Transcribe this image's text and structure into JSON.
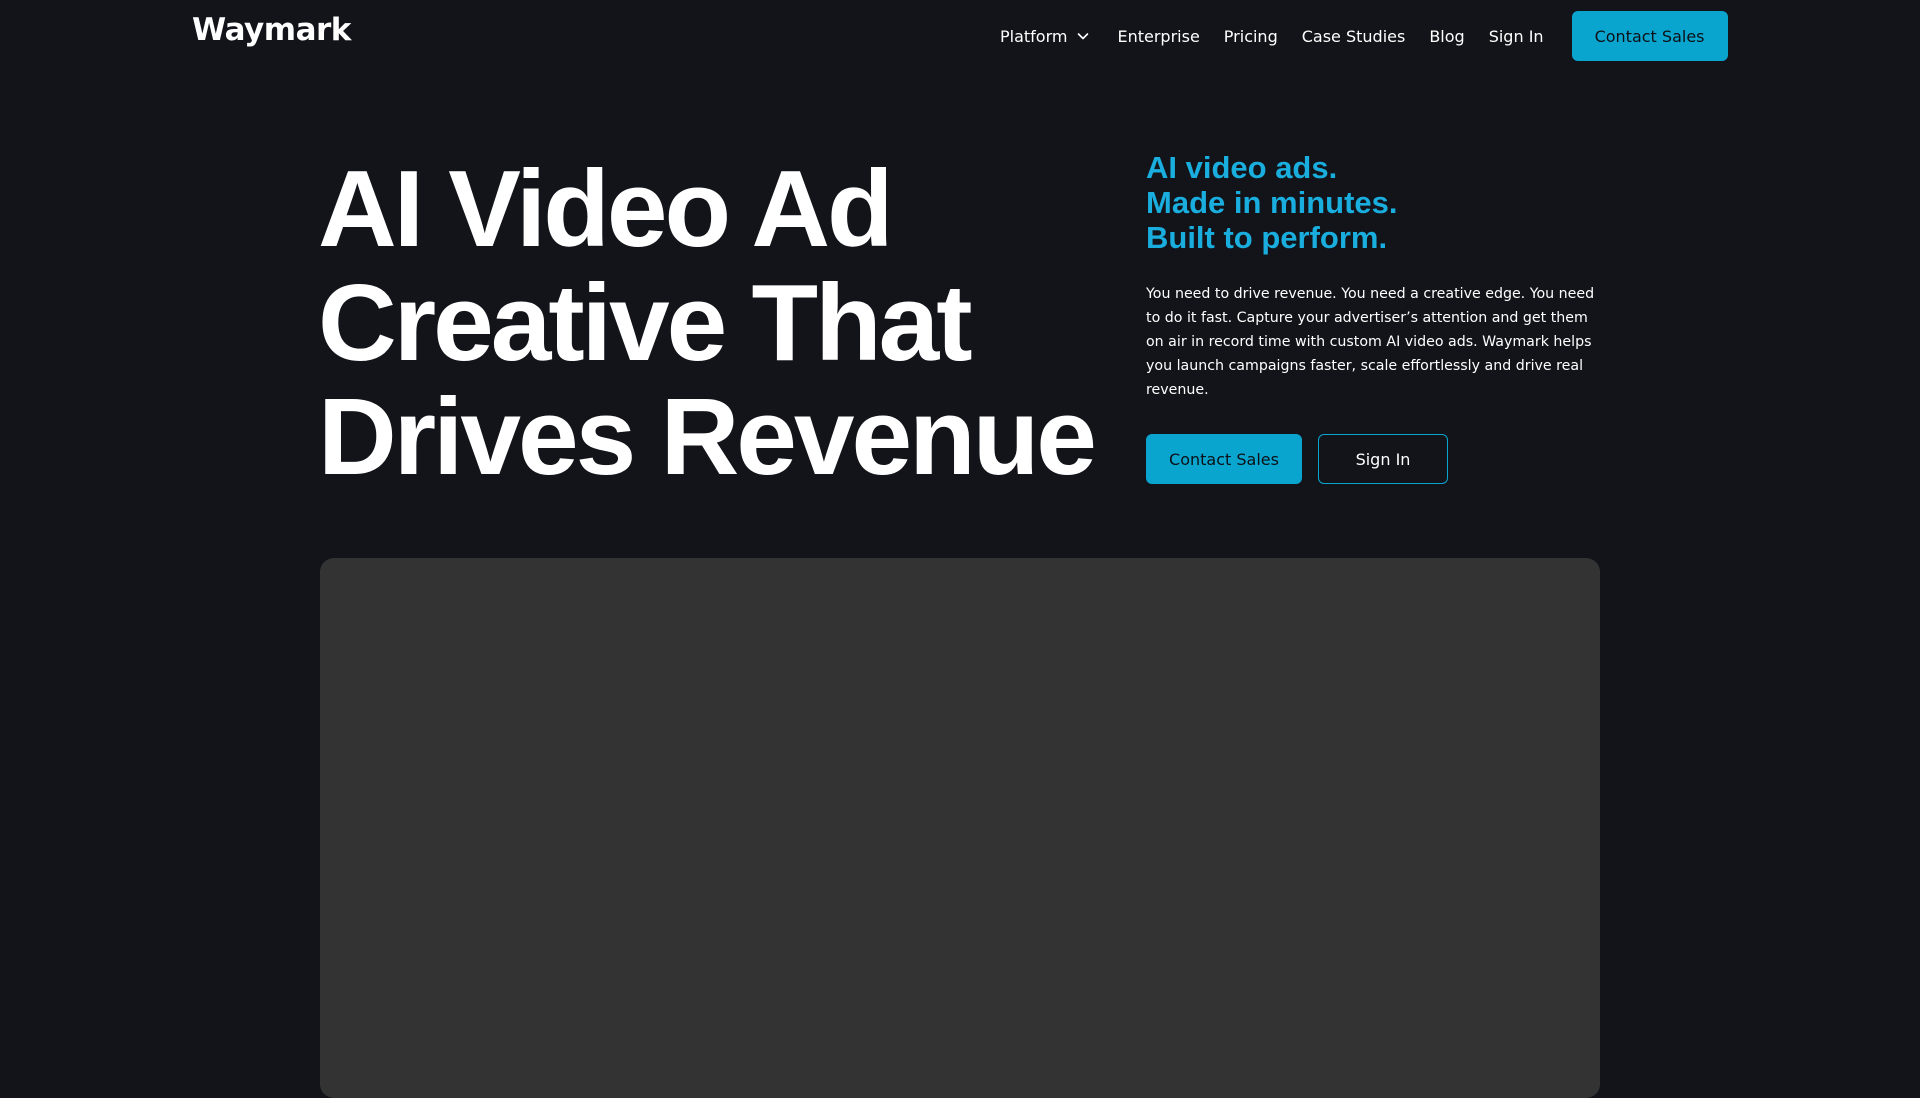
{
  "brand": {
    "logo_text": "Waymark"
  },
  "nav": {
    "items": [
      {
        "label": "Platform",
        "has_dropdown": true,
        "icon": "chevron-down-icon"
      },
      {
        "label": "Enterprise"
      },
      {
        "label": "Pricing"
      },
      {
        "label": "Case Studies"
      },
      {
        "label": "Blog"
      },
      {
        "label": "Sign In"
      }
    ],
    "cta_label": "Contact Sales"
  },
  "hero": {
    "title_lines": [
      "AI Video Ad",
      "Creative That",
      "Drives Revenue"
    ],
    "tagline_lines": [
      "AI video ads.",
      "Made in minutes.",
      "Built to perform."
    ],
    "description": "You need to drive revenue. You need a creative edge. You need to do it fast. Capture your advertiser’s attention and get them on air in record time with custom AI video ads. Waymark helps you launch campaigns faster, scale effortlessly and drive real revenue.",
    "primary_button": "Contact Sales",
    "secondary_button": "Sign In"
  },
  "colors": {
    "background": "#12141a",
    "accent": "#0aa5cf",
    "tagline": "#19aede",
    "video_panel": "#333333"
  }
}
